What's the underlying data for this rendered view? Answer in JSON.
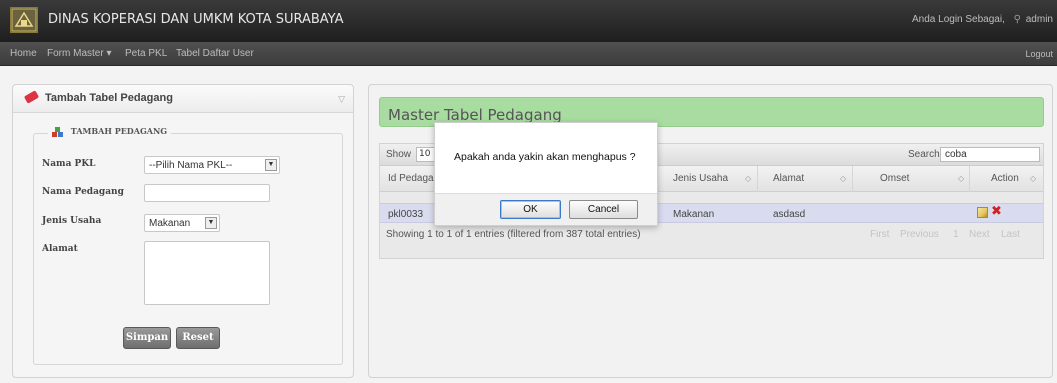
{
  "header": {
    "app_title": "DINAS KOPERASI DAN UMKM KOTA SURABAYA",
    "login_prefix": "Anda Login Sebagai,",
    "username": "admin"
  },
  "nav": {
    "items": [
      "Home",
      "Form Master ▾",
      "Peta PKL",
      "Tabel Daftar User"
    ],
    "logout": "Logout"
  },
  "left_panel": {
    "title": "Tambah Tabel Pedagang",
    "legend": "TAMBAH PEDAGANG",
    "fields": {
      "nama_pkl_label": "Nama PKL",
      "nama_pkl_value": "--Pilih Nama PKL--",
      "nama_pedagang_label": "Nama Pedagang",
      "jenis_usaha_label": "Jenis Usaha",
      "jenis_usaha_value": "Makanan",
      "alamat_label": "Alamat"
    },
    "buttons": {
      "save": "Simpan",
      "reset": "Reset"
    }
  },
  "right_panel": {
    "title": "Master Tabel Pedagang",
    "show_label": "Show",
    "show_value": "10",
    "search_label": "Search:",
    "search_value": "coba",
    "columns": [
      "Id Pedagang",
      "Jenis Usaha",
      "Alamat",
      "Omset",
      "Action"
    ],
    "rows": [
      {
        "id": "pkl0033",
        "jenis_usaha": "Makanan",
        "alamat": "asdasd",
        "omset": ""
      }
    ],
    "info": "Showing 1 to 1 of 1 entries (filtered from 387 total entries)",
    "pagination": [
      "First",
      "Previous",
      "1",
      "Next",
      "Last"
    ]
  },
  "dialog": {
    "message": "Apakah anda yakin akan menghapus ?",
    "ok_label": "OK",
    "cancel_label": "Cancel"
  },
  "colors": {
    "topbar": "#2b2b2b",
    "master_header": "#a8dca0",
    "selected_row": "#d9dcef",
    "delete_icon": "#d02020"
  }
}
